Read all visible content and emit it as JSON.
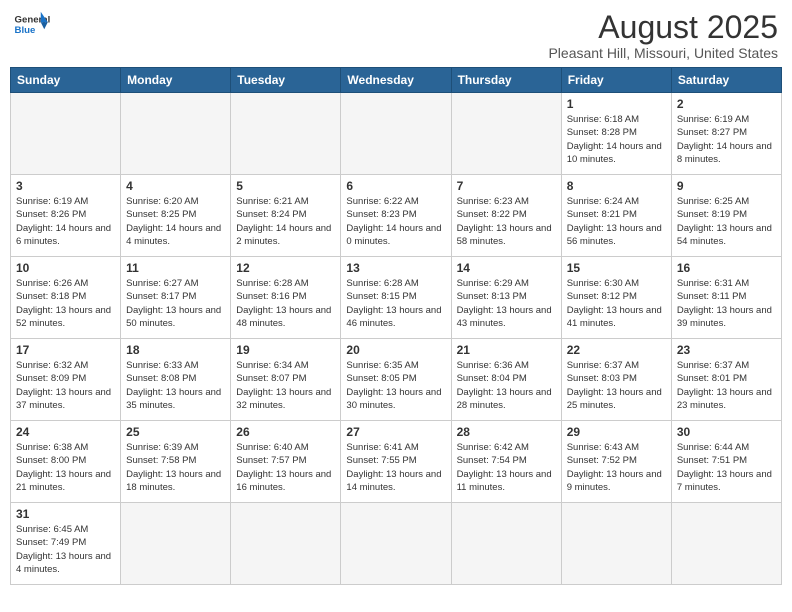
{
  "header": {
    "logo_general": "General",
    "logo_blue": "Blue",
    "title": "August 2025",
    "subtitle": "Pleasant Hill, Missouri, United States"
  },
  "days_of_week": [
    "Sunday",
    "Monday",
    "Tuesday",
    "Wednesday",
    "Thursday",
    "Friday",
    "Saturday"
  ],
  "weeks": [
    [
      {
        "day": "",
        "info": ""
      },
      {
        "day": "",
        "info": ""
      },
      {
        "day": "",
        "info": ""
      },
      {
        "day": "",
        "info": ""
      },
      {
        "day": "",
        "info": ""
      },
      {
        "day": "1",
        "info": "Sunrise: 6:18 AM\nSunset: 8:28 PM\nDaylight: 14 hours and 10 minutes."
      },
      {
        "day": "2",
        "info": "Sunrise: 6:19 AM\nSunset: 8:27 PM\nDaylight: 14 hours and 8 minutes."
      }
    ],
    [
      {
        "day": "3",
        "info": "Sunrise: 6:19 AM\nSunset: 8:26 PM\nDaylight: 14 hours and 6 minutes."
      },
      {
        "day": "4",
        "info": "Sunrise: 6:20 AM\nSunset: 8:25 PM\nDaylight: 14 hours and 4 minutes."
      },
      {
        "day": "5",
        "info": "Sunrise: 6:21 AM\nSunset: 8:24 PM\nDaylight: 14 hours and 2 minutes."
      },
      {
        "day": "6",
        "info": "Sunrise: 6:22 AM\nSunset: 8:23 PM\nDaylight: 14 hours and 0 minutes."
      },
      {
        "day": "7",
        "info": "Sunrise: 6:23 AM\nSunset: 8:22 PM\nDaylight: 13 hours and 58 minutes."
      },
      {
        "day": "8",
        "info": "Sunrise: 6:24 AM\nSunset: 8:21 PM\nDaylight: 13 hours and 56 minutes."
      },
      {
        "day": "9",
        "info": "Sunrise: 6:25 AM\nSunset: 8:19 PM\nDaylight: 13 hours and 54 minutes."
      }
    ],
    [
      {
        "day": "10",
        "info": "Sunrise: 6:26 AM\nSunset: 8:18 PM\nDaylight: 13 hours and 52 minutes."
      },
      {
        "day": "11",
        "info": "Sunrise: 6:27 AM\nSunset: 8:17 PM\nDaylight: 13 hours and 50 minutes."
      },
      {
        "day": "12",
        "info": "Sunrise: 6:28 AM\nSunset: 8:16 PM\nDaylight: 13 hours and 48 minutes."
      },
      {
        "day": "13",
        "info": "Sunrise: 6:28 AM\nSunset: 8:15 PM\nDaylight: 13 hours and 46 minutes."
      },
      {
        "day": "14",
        "info": "Sunrise: 6:29 AM\nSunset: 8:13 PM\nDaylight: 13 hours and 43 minutes."
      },
      {
        "day": "15",
        "info": "Sunrise: 6:30 AM\nSunset: 8:12 PM\nDaylight: 13 hours and 41 minutes."
      },
      {
        "day": "16",
        "info": "Sunrise: 6:31 AM\nSunset: 8:11 PM\nDaylight: 13 hours and 39 minutes."
      }
    ],
    [
      {
        "day": "17",
        "info": "Sunrise: 6:32 AM\nSunset: 8:09 PM\nDaylight: 13 hours and 37 minutes."
      },
      {
        "day": "18",
        "info": "Sunrise: 6:33 AM\nSunset: 8:08 PM\nDaylight: 13 hours and 35 minutes."
      },
      {
        "day": "19",
        "info": "Sunrise: 6:34 AM\nSunset: 8:07 PM\nDaylight: 13 hours and 32 minutes."
      },
      {
        "day": "20",
        "info": "Sunrise: 6:35 AM\nSunset: 8:05 PM\nDaylight: 13 hours and 30 minutes."
      },
      {
        "day": "21",
        "info": "Sunrise: 6:36 AM\nSunset: 8:04 PM\nDaylight: 13 hours and 28 minutes."
      },
      {
        "day": "22",
        "info": "Sunrise: 6:37 AM\nSunset: 8:03 PM\nDaylight: 13 hours and 25 minutes."
      },
      {
        "day": "23",
        "info": "Sunrise: 6:37 AM\nSunset: 8:01 PM\nDaylight: 13 hours and 23 minutes."
      }
    ],
    [
      {
        "day": "24",
        "info": "Sunrise: 6:38 AM\nSunset: 8:00 PM\nDaylight: 13 hours and 21 minutes."
      },
      {
        "day": "25",
        "info": "Sunrise: 6:39 AM\nSunset: 7:58 PM\nDaylight: 13 hours and 18 minutes."
      },
      {
        "day": "26",
        "info": "Sunrise: 6:40 AM\nSunset: 7:57 PM\nDaylight: 13 hours and 16 minutes."
      },
      {
        "day": "27",
        "info": "Sunrise: 6:41 AM\nSunset: 7:55 PM\nDaylight: 13 hours and 14 minutes."
      },
      {
        "day": "28",
        "info": "Sunrise: 6:42 AM\nSunset: 7:54 PM\nDaylight: 13 hours and 11 minutes."
      },
      {
        "day": "29",
        "info": "Sunrise: 6:43 AM\nSunset: 7:52 PM\nDaylight: 13 hours and 9 minutes."
      },
      {
        "day": "30",
        "info": "Sunrise: 6:44 AM\nSunset: 7:51 PM\nDaylight: 13 hours and 7 minutes."
      }
    ],
    [
      {
        "day": "31",
        "info": "Sunrise: 6:45 AM\nSunset: 7:49 PM\nDaylight: 13 hours and 4 minutes."
      },
      {
        "day": "",
        "info": ""
      },
      {
        "day": "",
        "info": ""
      },
      {
        "day": "",
        "info": ""
      },
      {
        "day": "",
        "info": ""
      },
      {
        "day": "",
        "info": ""
      },
      {
        "day": "",
        "info": ""
      }
    ]
  ]
}
